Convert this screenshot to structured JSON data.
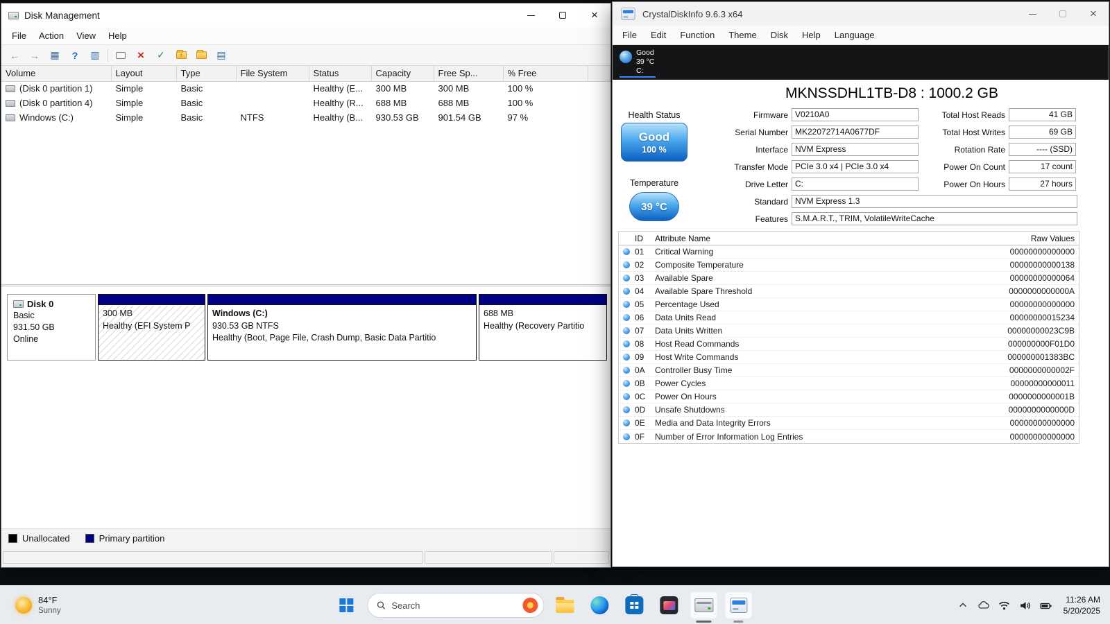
{
  "icons": {
    "back": "←",
    "forward": "→",
    "tree": "▦",
    "help": "?",
    "pane": "▥",
    "delete": "×",
    "check": "✓",
    "list": "▤",
    "close": "×",
    "up_arrow": "↑"
  },
  "disk_management": {
    "window_title": "Disk Management",
    "menu": [
      "File",
      "Action",
      "View",
      "Help"
    ],
    "table": {
      "columns": [
        "Volume",
        "Layout",
        "Type",
        "File System",
        "Status",
        "Capacity",
        "Free Sp...",
        "% Free"
      ],
      "rows": [
        {
          "volume": "(Disk 0 partition 1)",
          "layout": "Simple",
          "type": "Basic",
          "file_system": "",
          "status": "Healthy (E...",
          "capacity": "300 MB",
          "free_space": "300 MB",
          "pct_free": "100 %"
        },
        {
          "volume": "(Disk 0 partition 4)",
          "layout": "Simple",
          "type": "Basic",
          "file_system": "",
          "status": "Healthy (R...",
          "capacity": "688 MB",
          "free_space": "688 MB",
          "pct_free": "100 %"
        },
        {
          "volume": "Windows (C:)",
          "layout": "Simple",
          "type": "Basic",
          "file_system": "NTFS",
          "status": "Healthy (B...",
          "capacity": "930.53 GB",
          "free_space": "901.54 GB",
          "pct_free": "97 %"
        }
      ]
    },
    "disk0": {
      "name": "Disk 0",
      "kind": "Basic",
      "size": "931.50 GB",
      "state": "Online",
      "partitions": [
        {
          "lines": [
            "300 MB",
            "Healthy (EFI System P"
          ]
        },
        {
          "lines": [
            "Windows  (C:)",
            "930.53 GB NTFS",
            "Healthy (Boot, Page File, Crash Dump, Basic Data Partitio"
          ]
        },
        {
          "lines": [
            "688 MB",
            "Healthy (Recovery Partitio"
          ]
        }
      ]
    },
    "legend": [
      {
        "label": "Unallocated",
        "color": "#000000"
      },
      {
        "label": "Primary partition",
        "color": "#000082"
      }
    ]
  },
  "cdi": {
    "window_title": "CrystalDiskInfo 9.6.3 x64",
    "menu": [
      "File",
      "Edit",
      "Function",
      "Theme",
      "Disk",
      "Help",
      "Language"
    ],
    "drive_tab": {
      "health": "Good",
      "temperature": "39 °C",
      "letter": "C:"
    },
    "model": "MKNSSDHL1TB-D8 : 1000.2 GB",
    "health_status": {
      "label": "Health Status",
      "value": "Good",
      "percent": "100 %"
    },
    "temperature": {
      "label": "Temperature",
      "value": "39 °C"
    },
    "info_rows": [
      {
        "l": "Firmware",
        "v": "V0210A0",
        "r": "Total Host Reads",
        "rv": "41 GB"
      },
      {
        "l": "Serial Number",
        "v": "MK22072714A0677DF",
        "r": "Total Host Writes",
        "rv": "69 GB"
      },
      {
        "l": "Interface",
        "v": "NVM Express",
        "r": "Rotation Rate",
        "rv": "---- (SSD)"
      },
      {
        "l": "Transfer Mode",
        "v": "PCIe 3.0 x4 | PCIe 3.0 x4",
        "r": "Power On Count",
        "rv": "17 count"
      },
      {
        "l": "Drive Letter",
        "v": "C:",
        "r": "Power On Hours",
        "rv": "27 hours"
      }
    ],
    "standard": {
      "label": "Standard",
      "value": "NVM Express 1.3"
    },
    "features": {
      "label": "Features",
      "value": "S.M.A.R.T., TRIM, VolatileWriteCache"
    },
    "smart": {
      "columns": [
        "ID",
        "Attribute Name",
        "Raw Values"
      ],
      "rows": [
        [
          "01",
          "Critical Warning",
          "00000000000000"
        ],
        [
          "02",
          "Composite Temperature",
          "00000000000138"
        ],
        [
          "03",
          "Available Spare",
          "00000000000064"
        ],
        [
          "04",
          "Available Spare Threshold",
          "0000000000000A"
        ],
        [
          "05",
          "Percentage Used",
          "00000000000000"
        ],
        [
          "06",
          "Data Units Read",
          "00000000015234"
        ],
        [
          "07",
          "Data Units Written",
          "00000000023C9B"
        ],
        [
          "08",
          "Host Read Commands",
          "000000000F01D0"
        ],
        [
          "09",
          "Host Write Commands",
          "000000001383BC"
        ],
        [
          "0A",
          "Controller Busy Time",
          "0000000000002F"
        ],
        [
          "0B",
          "Power Cycles",
          "00000000000011"
        ],
        [
          "0C",
          "Power On Hours",
          "0000000000001B"
        ],
        [
          "0D",
          "Unsafe Shutdowns",
          "0000000000000D"
        ],
        [
          "0E",
          "Media and Data Integrity Errors",
          "00000000000000"
        ],
        [
          "0F",
          "Number of Error Information Log Entries",
          "00000000000000"
        ]
      ]
    }
  },
  "taskbar": {
    "weather": {
      "temp": "84°F",
      "condition": "Sunny"
    },
    "search": {
      "placeholder": "Search"
    },
    "clock": {
      "time": "11:26 AM",
      "date": "5/20/2025"
    }
  }
}
